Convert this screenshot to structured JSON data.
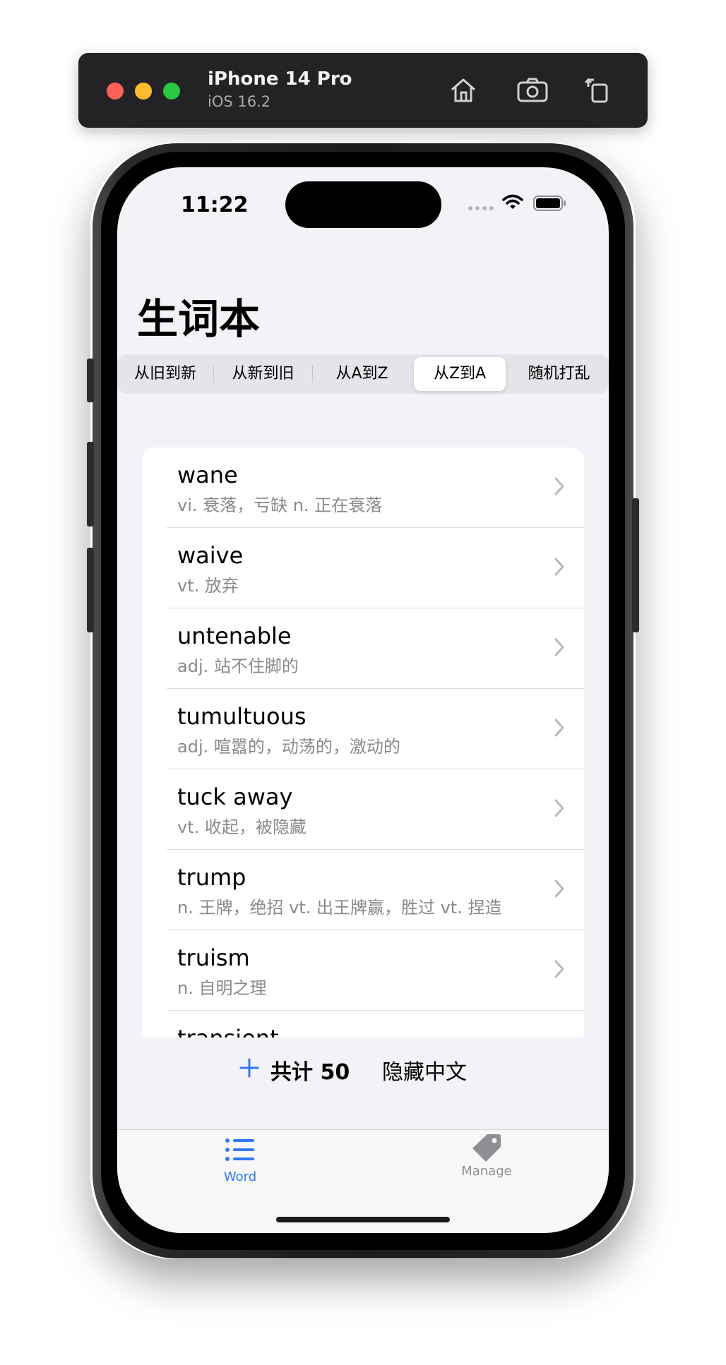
{
  "simulator": {
    "device_name": "iPhone 14 Pro",
    "os_version": "iOS 16.2",
    "icons": [
      "home-icon",
      "screenshot-icon",
      "rotate-icon"
    ]
  },
  "status_bar": {
    "time": "11:22"
  },
  "nav": {
    "title": "生词本"
  },
  "sort_control": {
    "options": [
      "从旧到新",
      "从新到旧",
      "从A到Z",
      "从Z到A",
      "随机打乱"
    ],
    "selected": "从Z到A"
  },
  "words": [
    {
      "word": "wane",
      "meaning": "vi. 衰落，亏缺 n. 正在衰落"
    },
    {
      "word": "waive",
      "meaning": "vt. 放弃"
    },
    {
      "word": "untenable",
      "meaning": "adj. 站不住脚的"
    },
    {
      "word": "tumultuous",
      "meaning": "adj. 喧嚣的，动荡的，激动的"
    },
    {
      "word": "tuck away",
      "meaning": "vt. 收起，被隐藏"
    },
    {
      "word": "trump",
      "meaning": "n. 王牌，绝招 vt. 出王牌赢，胜过 vt. 捏造"
    },
    {
      "word": "truism",
      "meaning": "n. 自明之理"
    },
    {
      "word": "transient",
      "meaning": ""
    }
  ],
  "footer": {
    "total_label": "共计 50",
    "hide_chinese_label": "隐藏中文"
  },
  "tabs": [
    {
      "label": "Word",
      "icon": "list-icon",
      "active": true
    },
    {
      "label": "Manage",
      "icon": "tag-icon",
      "active": false
    }
  ],
  "colors": {
    "accent": "#3478f6",
    "secondary_text": "#8a8a8e",
    "inactive_tab": "#8e8e93"
  }
}
